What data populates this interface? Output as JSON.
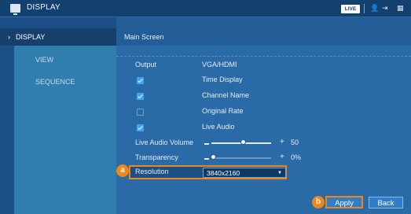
{
  "titlebar": {
    "title": "DISPLAY",
    "live_badge": "LIVE"
  },
  "sidebar": {
    "items": [
      {
        "label": "DISPLAY",
        "chevron": "›",
        "active": true
      },
      {
        "label": "VIEW"
      },
      {
        "label": "SEQUENCE"
      }
    ]
  },
  "main": {
    "title": "Main Screen",
    "output": {
      "label": "Output",
      "value": "VGA/HDMI"
    },
    "options": [
      {
        "label": "Time Display",
        "checked": true
      },
      {
        "label": "Channel Name",
        "checked": true
      },
      {
        "label": "Original Rate",
        "checked": false
      },
      {
        "label": "Live Audio",
        "checked": true
      }
    ],
    "live_audio_volume": {
      "label": "Live Audio Volume",
      "value": "50",
      "level": 50
    },
    "transparency": {
      "label": "Transparency",
      "value": "0%",
      "level": 0
    },
    "resolution": {
      "label": "Resolution",
      "value": "3840x2160"
    }
  },
  "markers": {
    "a": "a",
    "b": "b"
  },
  "buttons": {
    "apply": "Apply",
    "back": "Back"
  },
  "colors": {
    "accent": "#f0861a",
    "button": "#2f7ec7"
  }
}
